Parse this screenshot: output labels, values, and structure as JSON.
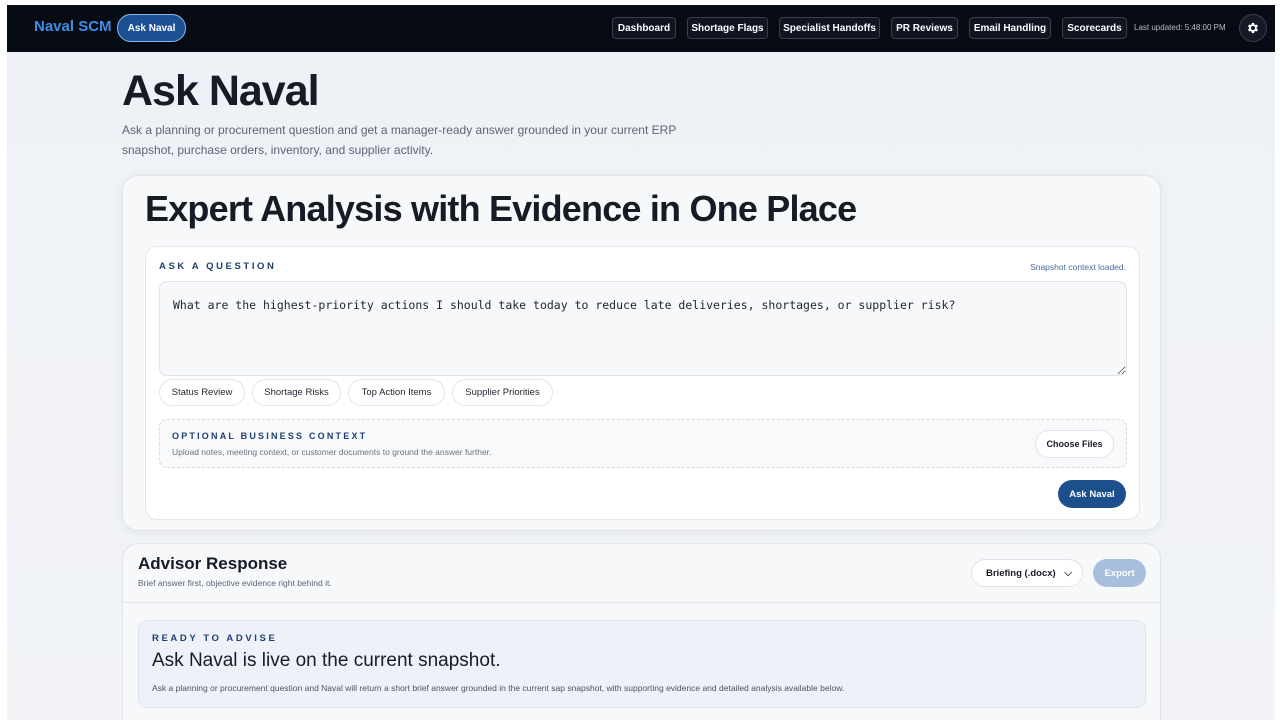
{
  "nav": {
    "brand": "Naval SCM",
    "active_pill": "Ask Naval",
    "items": [
      {
        "label": "Dashboard"
      },
      {
        "label": "Shortage Flags"
      },
      {
        "label": "Specialist Handoffs"
      },
      {
        "label": "PR Reviews"
      },
      {
        "label": "Email Handling"
      },
      {
        "label": "Scorecards"
      }
    ],
    "last_updated": "Last updated: 5:48:00 PM",
    "settings_icon": "gear-icon"
  },
  "header": {
    "title": "Ask Naval",
    "subtitle": "Ask a planning or procurement question and get a manager-ready answer grounded in your current ERP snapshot, purchase orders, inventory, and supplier activity."
  },
  "ask_card": {
    "hero": "Expert Analysis with Evidence in One Place",
    "label": "ASK A QUESTION",
    "status": "Snapshot context loaded.",
    "question": "What are the highest-priority actions I should take today to reduce late deliveries, shortages, or supplier risk?",
    "chips": [
      "Status Review",
      "Shortage Risks",
      "Top Action Items",
      "Supplier Priorities"
    ],
    "context": {
      "title": "OPTIONAL BUSINESS CONTEXT",
      "description": "Upload notes, meeting context, or customer documents to ground the answer further.",
      "button": "Choose Files"
    },
    "submit": "Ask Naval"
  },
  "advisor": {
    "title": "Advisor Response",
    "subtitle": "Brief answer first, objective evidence right behind it.",
    "format_selected": "Briefing (.docx)",
    "export": "Export",
    "ready": {
      "label": "READY TO ADVISE",
      "headline": "Ask Naval is live on the current snapshot.",
      "description": "Ask a planning or procurement question and Naval will return a short brief answer grounded in the current sap snapshot, with supporting evidence and detailed analysis available below."
    }
  },
  "colors": {
    "nav_bg": "#070b14",
    "brand": "#3d8fe6",
    "primary": "#1c4f8c",
    "label": "#1d3f73",
    "export_disabled": "#a6bfdd"
  }
}
